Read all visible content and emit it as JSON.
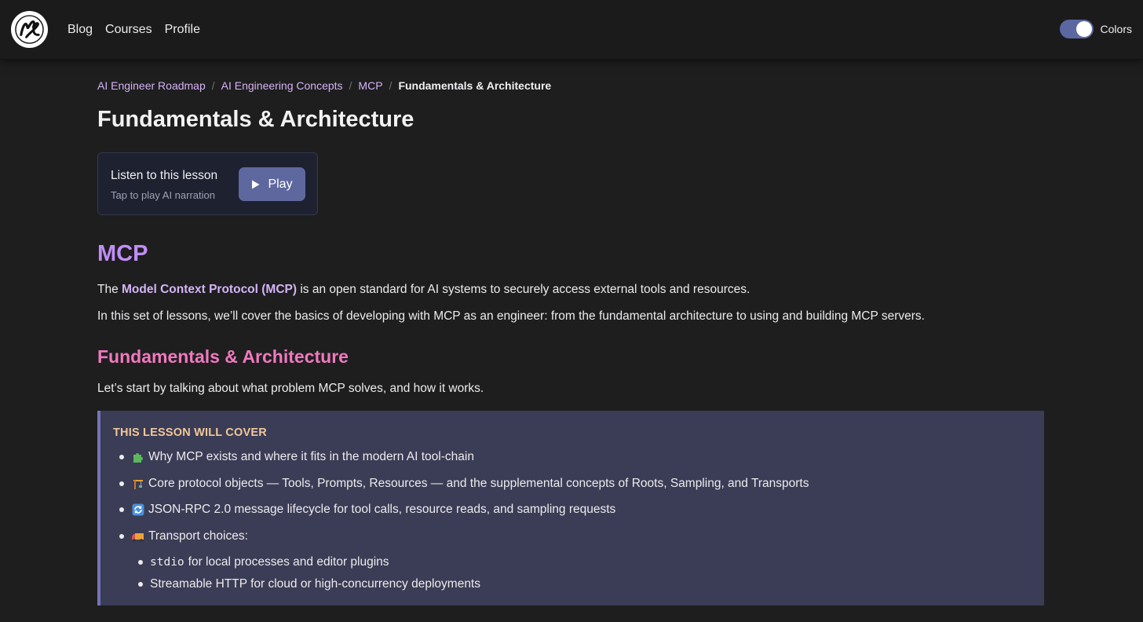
{
  "nav": {
    "items": [
      {
        "label": "Blog"
      },
      {
        "label": "Courses"
      },
      {
        "label": "Profile"
      }
    ],
    "toggle_label": "Colors",
    "toggle_on": true
  },
  "breadcrumb": {
    "links": [
      "AI Engineer Roadmap",
      "AI Engineering Concepts",
      "MCP"
    ],
    "current": "Fundamentals & Architecture",
    "separator": "/"
  },
  "page": {
    "title": "Fundamentals & Architecture"
  },
  "audio": {
    "title": "Listen to this lesson",
    "subtitle": "Tap to play AI narration",
    "play_label": "Play"
  },
  "article": {
    "h_mcp": "MCP",
    "para1_prefix": "The ",
    "para1_strong": "Model Context Protocol (MCP)",
    "para1_suffix": " is an open standard for AI systems to securely access external tools and resources.",
    "para2": "In this set of lessons, we’ll cover the basics of developing with MCP as an engineer: from the fundamental architecture to using and building MCP servers.",
    "h_fund": "Fundamentals & Architecture",
    "para3": "Let’s start by talking about what problem MCP solves, and how it works."
  },
  "cover": {
    "title": "THIS LESSON WILL COVER",
    "items": [
      {
        "icon": "puzzle-icon",
        "text": "Why MCP exists and where it fits in the modern AI tool-chain"
      },
      {
        "icon": "construction-icon",
        "text": "Core protocol objects — Tools, Prompts, Resources — and the supplemental concepts of Roots, Sampling, and Transports"
      },
      {
        "icon": "cycle-icon",
        "text": "JSON-RPC 2.0 message lifecycle for tool calls, resource reads, and sampling requests"
      },
      {
        "icon": "truck-icon",
        "text": "Transport choices:"
      }
    ],
    "subitems": [
      {
        "code": "stdio",
        "text": "for local processes and editor plugins"
      },
      {
        "text": "Streamable HTTP for cloud or high-concurrency deployments"
      }
    ]
  },
  "colors": {
    "background": "#1e1e1f",
    "link": "#d4b4f5",
    "h2": "#c08ef7",
    "h3": "#f079be",
    "callout_bg": "#3b3c55",
    "callout_title": "#f1c89a",
    "button": "#5e689e"
  }
}
